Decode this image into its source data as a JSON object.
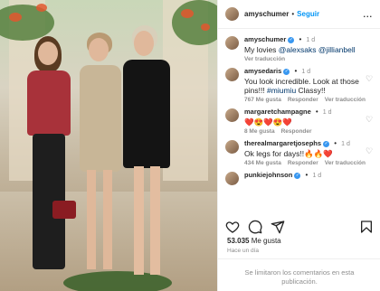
{
  "post": {
    "author": "amyschumer",
    "follow_label": "Seguir",
    "separator": "•",
    "more_label": "..."
  },
  "comments": [
    {
      "user": "amyschumer",
      "verified": true,
      "time": "1 d",
      "text_parts": [
        "My lovies ",
        "@alexsaks",
        " ",
        "@jillianbell"
      ],
      "actions": [
        "Ver traducción"
      ]
    },
    {
      "user": "amysedaris",
      "verified": true,
      "time": "1 d",
      "text_parts": [
        "You look incredible. Look at those pins!!! ",
        "#miumiu",
        " Classy!!"
      ],
      "likes": "767 Me gusta",
      "actions": [
        "Responder",
        "Ver traducción"
      ]
    },
    {
      "user": "margaretchampagne",
      "verified": false,
      "time": "1 d",
      "text_parts": [
        "❤️😍❤️😍❤️"
      ],
      "likes": "8 Me gusta",
      "actions": [
        "Responder"
      ]
    },
    {
      "user": "therealmargaretjosephs",
      "verified": true,
      "time": "1 d",
      "text_parts": [
        "Ok legs for days!!🔥🔥❤️"
      ],
      "likes": "434 Me gusta",
      "actions": [
        "Responder",
        "Ver traducción"
      ]
    },
    {
      "user": "punkiejohnson",
      "verified": true,
      "time": "1 d",
      "text_parts": [
        ""
      ]
    }
  ],
  "icons": {
    "like": "heart-icon",
    "comment": "comment-icon",
    "share": "share-icon",
    "save": "bookmark-icon"
  },
  "stats": {
    "likes_count": "53.035",
    "likes_label": "Me gusta",
    "posted": "Hace un día"
  },
  "comments_limited": "Se limitaron los comentarios en esta publicación."
}
